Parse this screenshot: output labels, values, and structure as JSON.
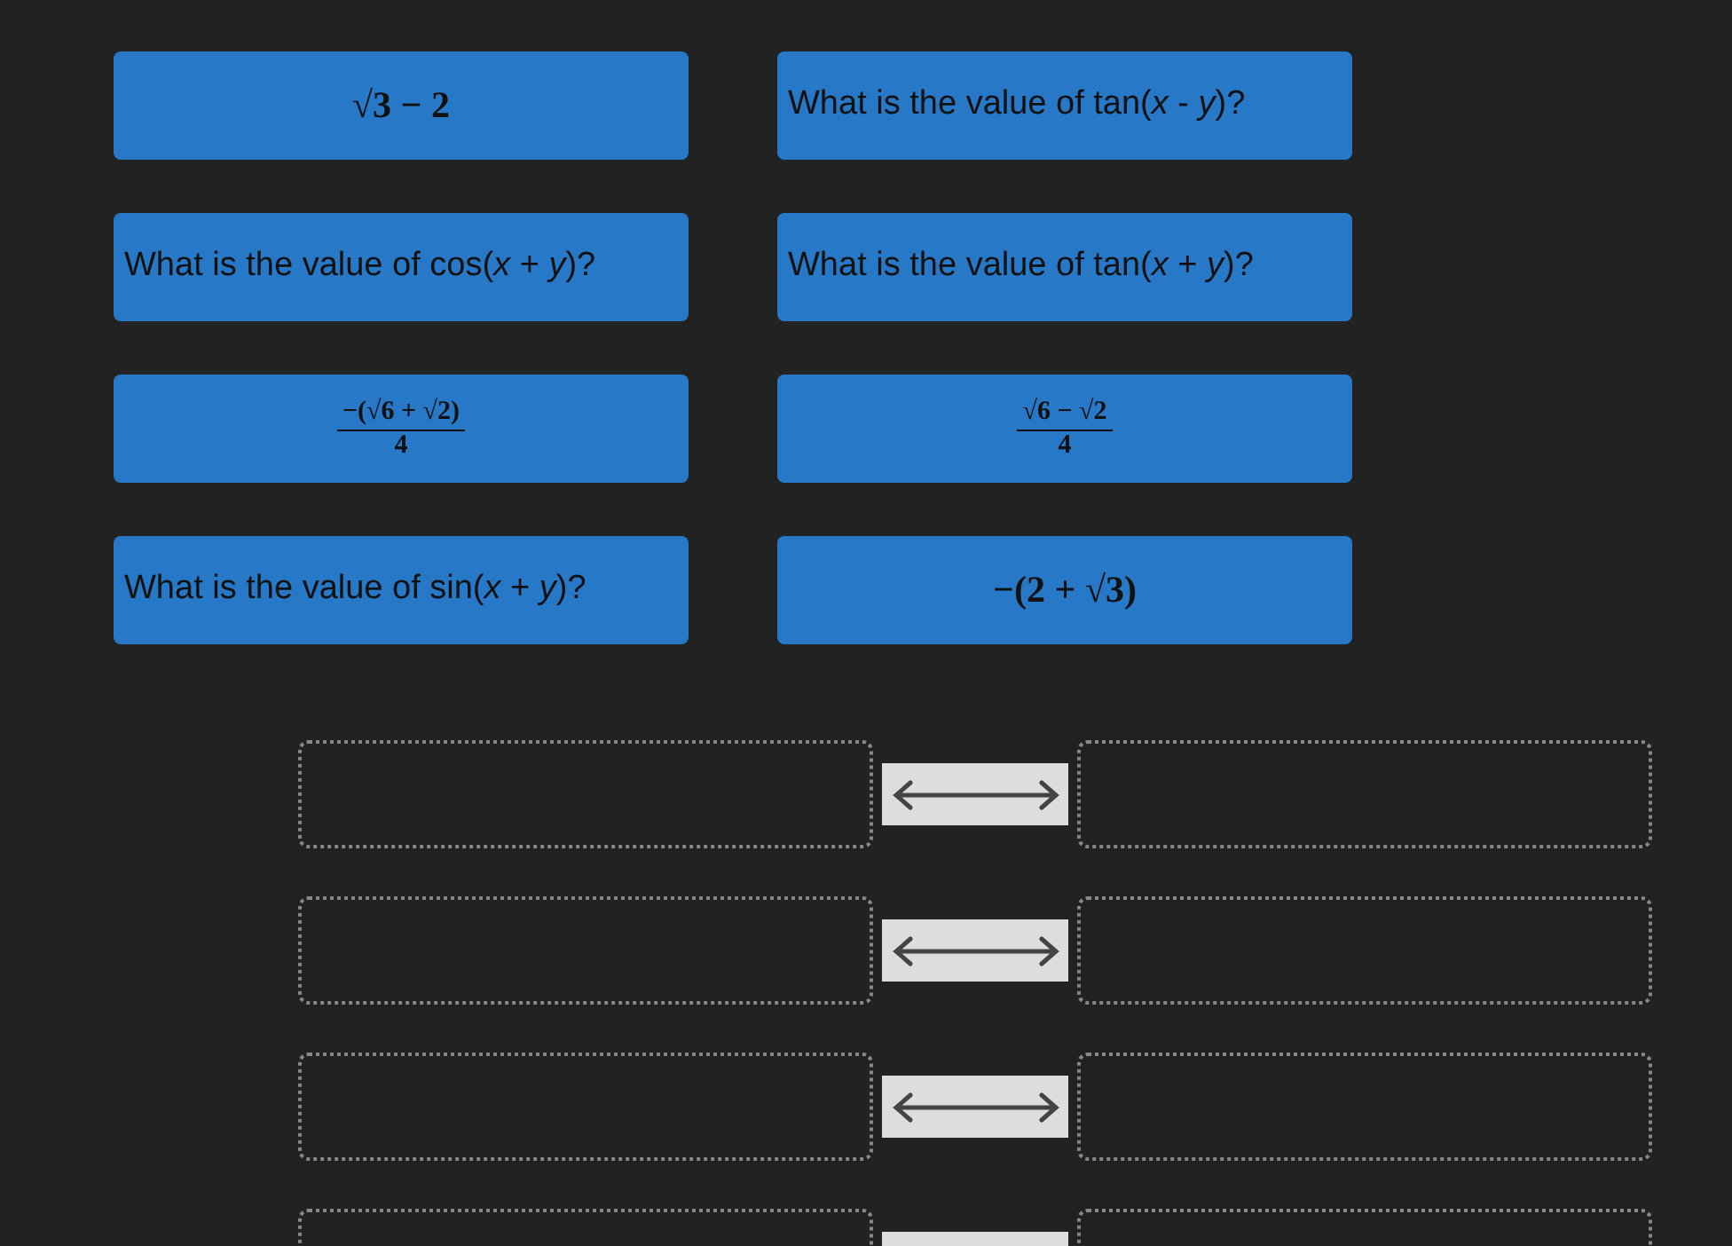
{
  "tiles": [
    {
      "kind": "expression",
      "text": "√3 − 2"
    },
    {
      "kind": "question",
      "text": "What is the value of tan(*x* - *y*)?"
    },
    {
      "kind": "question",
      "text": "What is the value of cos(*x* + *y*)?"
    },
    {
      "kind": "question",
      "text": "What is the value of tan(*x* + *y*)?"
    },
    {
      "kind": "fraction",
      "numerator": "−(√6 + √2)",
      "denominator": "4"
    },
    {
      "kind": "fraction",
      "numerator": "√6 − √2",
      "denominator": "4"
    },
    {
      "kind": "question",
      "text": "What is the value of sin(*x* + *y*)?"
    },
    {
      "kind": "expression",
      "text": "−(2 + √3)"
    }
  ],
  "pairs": [
    {
      "left_filled": false,
      "right_filled": false
    },
    {
      "left_filled": false,
      "right_filled": false
    },
    {
      "left_filled": false,
      "right_filled": false
    },
    {
      "left_filled": false,
      "right_filled": false
    }
  ]
}
